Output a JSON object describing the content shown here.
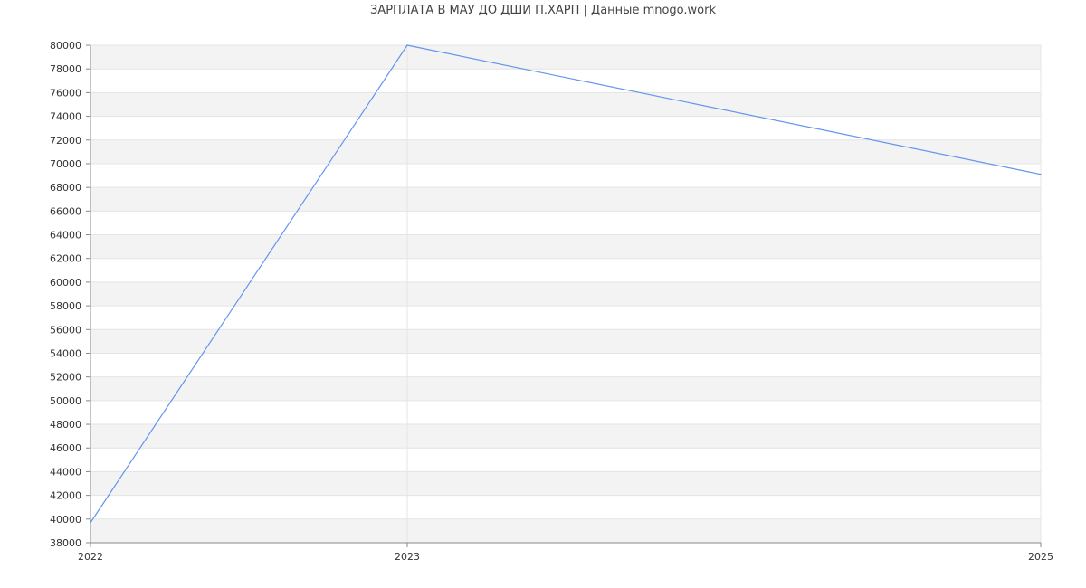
{
  "chart_data": {
    "type": "line",
    "title": "ЗАРПЛАТА В МАУ ДО ДШИ П.ХАРП | Данные mnogo.work",
    "xlabel": "",
    "ylabel": "",
    "x_ticks": [
      "2022",
      "2023",
      "2025"
    ],
    "xlim": [
      2022,
      2025
    ],
    "ylim": [
      38000,
      80000
    ],
    "y_ticks": [
      38000,
      40000,
      42000,
      44000,
      46000,
      48000,
      50000,
      52000,
      54000,
      56000,
      58000,
      60000,
      62000,
      64000,
      66000,
      68000,
      70000,
      72000,
      74000,
      76000,
      78000,
      80000
    ],
    "grid": true,
    "legend": "none",
    "series": [
      {
        "color": "#6495ed",
        "x": [
          2022,
          2023,
          2025
        ],
        "values": [
          39700,
          80000,
          69100
        ]
      }
    ],
    "colors": {
      "line": "#6495ed",
      "band": "#f3f3f3",
      "grid": "#e4e4e4",
      "axis": "#888888"
    }
  }
}
